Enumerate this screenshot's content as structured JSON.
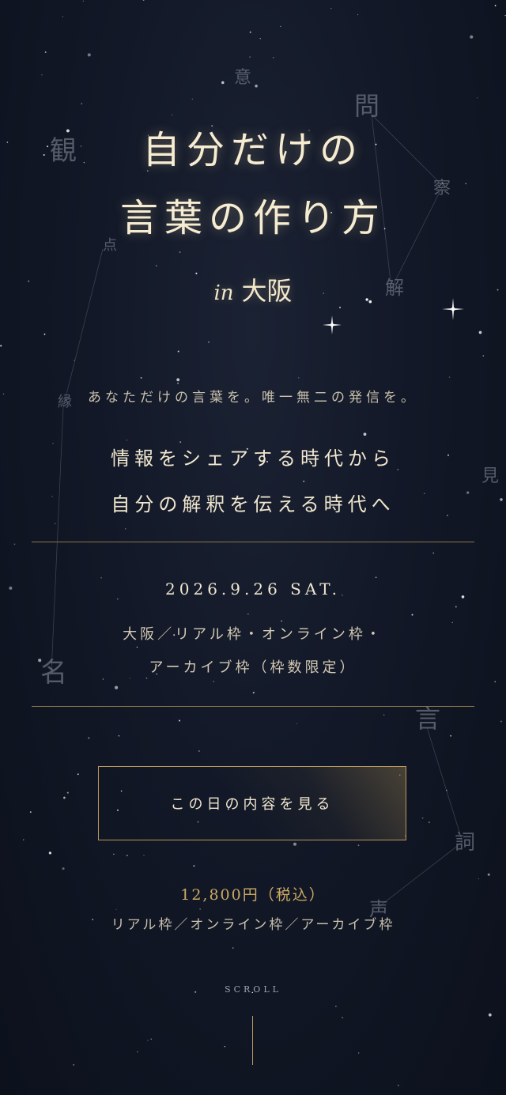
{
  "hero": {
    "title_line1": "自分だけの",
    "title_line2": "言葉の作り方",
    "subtitle_in": "in",
    "subtitle_city": "大阪"
  },
  "background_kanji": [
    "意",
    "問",
    "観",
    "察",
    "点",
    "解",
    "縁",
    "見",
    "名",
    "言",
    "詞",
    "声"
  ],
  "tagline": "あなただけの言葉を。唯一無二の発信を。",
  "lead": {
    "line1": "情報をシェアする時代から",
    "line2": "自分の解釈を伝える時代へ"
  },
  "event": {
    "date": "2026.9.26 SAT.",
    "venue_line1": "大阪／リアル枠・オンライン枠・",
    "venue_line2": "アーカイブ枠（枠数限定）"
  },
  "cta": {
    "label": "この日の内容を見る"
  },
  "pricing": {
    "price": "12,800円（税込）",
    "plans": "リアル枠／オンライン枠／アーカイブ枠"
  },
  "scroll_label": "SCROLL",
  "colors": {
    "background": "#121827",
    "gold": "#b8975a",
    "cream": "#f6ecd2"
  }
}
